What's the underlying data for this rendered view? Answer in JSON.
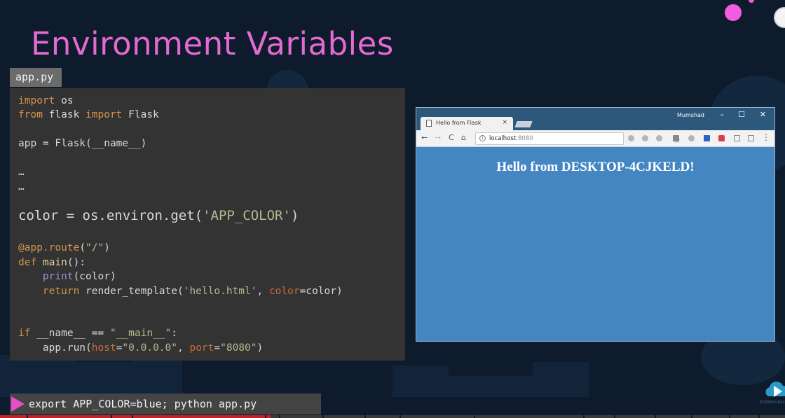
{
  "slide": {
    "title": "Environment Variables"
  },
  "code_editor": {
    "filename": "app.py",
    "lines": [
      {
        "a": "import",
        "b": " os"
      },
      {
        "a": "from",
        "b": " flask ",
        "c": "import",
        "d": " Flask"
      },
      {
        "a": "app = Flask(__name__)"
      },
      {
        "a": "…"
      },
      {
        "a": "…"
      },
      {
        "a": "color = os.environ.get(",
        "b": "'APP_COLOR'",
        "c": ")"
      },
      {
        "a": "@app.route",
        "b": "(",
        "c": "\"/\"",
        "d": ")"
      },
      {
        "a": "def",
        "b": " main",
        "c": "():"
      },
      {
        "a": "    ",
        "b": "print",
        "c": "(color)"
      },
      {
        "a": "    ",
        "b": "return",
        "c": " render_template(",
        "d": "'hello.html'",
        "e": ", ",
        "f": "color",
        "g": "=color)"
      },
      {
        "a": "if",
        "b": " __name__ == ",
        "c": "\"__main__\"",
        "d": ":"
      },
      {
        "a": "    app.run(",
        "b": "host",
        "c": "=",
        "d": "\"0.0.0.0\"",
        "e": ", ",
        "f": "port",
        "g": "=",
        "h": "\"8080\"",
        "i": ")"
      }
    ]
  },
  "browser": {
    "tab_title": "Hello from Flask",
    "tab_close": "×",
    "user_name": "Mumshad",
    "window_controls": {
      "minimize": "–",
      "maximize": "☐",
      "close": "✕"
    },
    "nav": {
      "back": "←",
      "forward": "→",
      "reload": "C",
      "home": "⌂"
    },
    "url_host": "localhost",
    "url_port": ":8080",
    "bookmark_star": "☆",
    "menu": "⋮",
    "page_heading": "Hello from DESKTOP-4CJKELD!",
    "page_background": "#4386c2"
  },
  "terminal": {
    "command": "export APP_COLOR=blue; python app.py"
  },
  "colors": {
    "title": "#e26ad0",
    "accent": "#e44ecb",
    "code_background": "#333333",
    "keyword": "#d4944a",
    "string": "#b8b88e",
    "builtin": "#9b8ed8"
  },
  "progress": {
    "played_fraction": 0.345
  },
  "icons": {
    "terminal_prompt": "play-triangle-icon",
    "brand": "cloud-play-logo-icon"
  }
}
